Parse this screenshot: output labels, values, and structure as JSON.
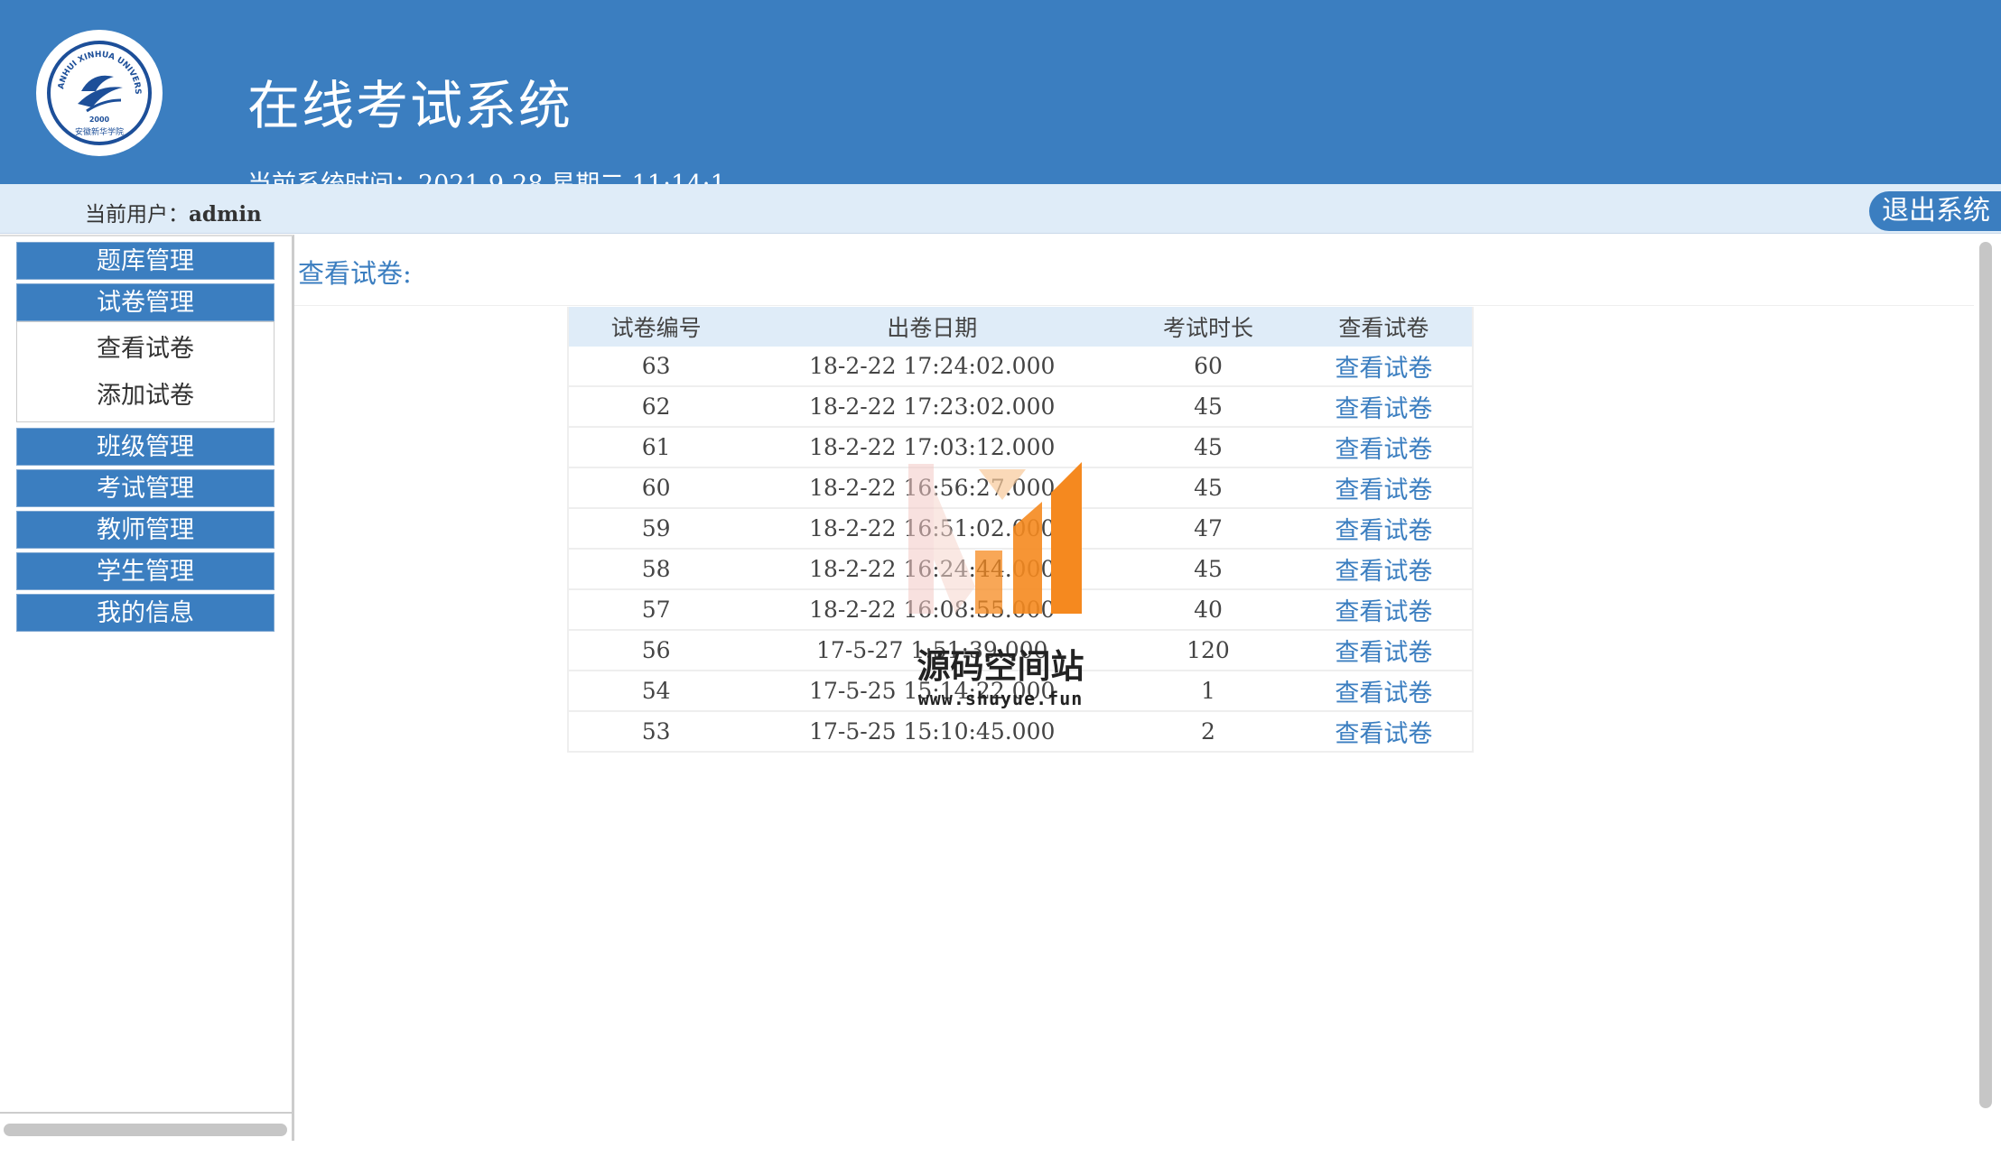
{
  "header": {
    "title": "在线考试系统",
    "system_time": "当前系统时间：2021-9-28 星期二 11:14:1",
    "logo_text": "ANHUI XINHUA UNIVERSITY",
    "logo_year": "2000",
    "logo_subtext": "安徽新华学院"
  },
  "userbar": {
    "user_label": "当前用户：",
    "username": "admin",
    "logout_label": "退出系统"
  },
  "sidebar": {
    "items": [
      {
        "label": "题库管理"
      },
      {
        "label": "试卷管理",
        "expanded": true,
        "children": [
          {
            "label": "查看试卷"
          },
          {
            "label": "添加试卷"
          }
        ]
      },
      {
        "label": "班级管理"
      },
      {
        "label": "考试管理"
      },
      {
        "label": "教师管理"
      },
      {
        "label": "学生管理"
      },
      {
        "label": "我的信息"
      }
    ]
  },
  "main": {
    "heading": "查看试卷:",
    "table": {
      "columns": [
        "试卷编号",
        "出卷日期",
        "考试时长",
        "查看试卷"
      ],
      "rows": [
        {
          "id": "63",
          "date": "18-2-22 17:24:02.000",
          "duration": "60",
          "action": "查看试卷"
        },
        {
          "id": "62",
          "date": "18-2-22 17:23:02.000",
          "duration": "45",
          "action": "查看试卷"
        },
        {
          "id": "61",
          "date": "18-2-22 17:03:12.000",
          "duration": "45",
          "action": "查看试卷"
        },
        {
          "id": "60",
          "date": "18-2-22 16:56:27.000",
          "duration": "45",
          "action": "查看试卷"
        },
        {
          "id": "59",
          "date": "18-2-22 16:51:02.000",
          "duration": "47",
          "action": "查看试卷"
        },
        {
          "id": "58",
          "date": "18-2-22 16:24:44.000",
          "duration": "45",
          "action": "查看试卷"
        },
        {
          "id": "57",
          "date": "18-2-22 16:08:55.000",
          "duration": "40",
          "action": "查看试卷"
        },
        {
          "id": "56",
          "date": "17-5-27 1:51:39.000",
          "duration": "120",
          "action": "查看试卷"
        },
        {
          "id": "54",
          "date": "17-5-25 15:14:22.000",
          "duration": "1",
          "action": "查看试卷"
        },
        {
          "id": "53",
          "date": "17-5-25 15:10:45.000",
          "duration": "2",
          "action": "查看试卷"
        }
      ]
    }
  },
  "watermark": {
    "name": "源码空间站",
    "url": "www.shuyue.fun"
  },
  "colors": {
    "brand_blue": "#3b7ec0",
    "header_light": "#dfecf8",
    "watermark_orange": "#f5891f"
  }
}
